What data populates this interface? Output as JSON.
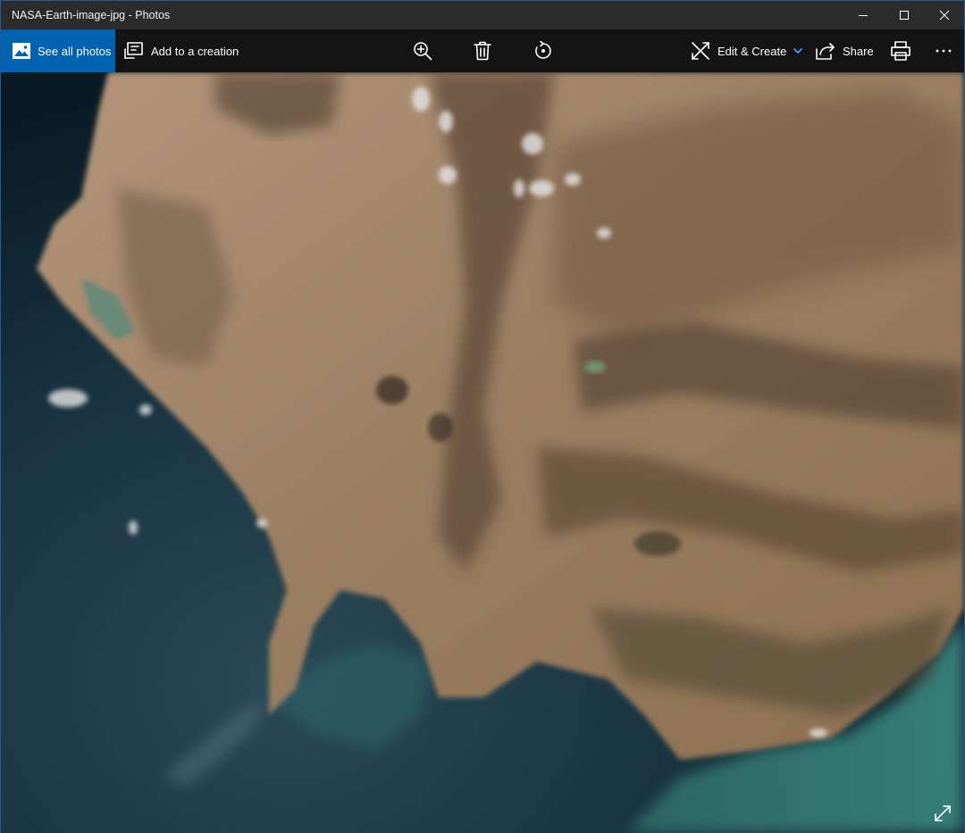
{
  "window": {
    "title": "NASA-Earth-image-jpg - Photos"
  },
  "toolbar": {
    "see_all_photos": "See all photos",
    "add_to_creation": "Add to a creation",
    "edit_create": "Edit & Create",
    "share": "Share"
  },
  "colors": {
    "accent": "#0063b1",
    "titlebar": "#2b2b2b",
    "toolbar": "#141414",
    "chevron": "#3aa0ff"
  },
  "icons": {
    "zoom": "zoom-in-icon",
    "delete": "trash-icon",
    "rotate": "rotate-icon",
    "print": "printer-icon",
    "more": "more-icon",
    "expand": "fullscreen-icon"
  }
}
